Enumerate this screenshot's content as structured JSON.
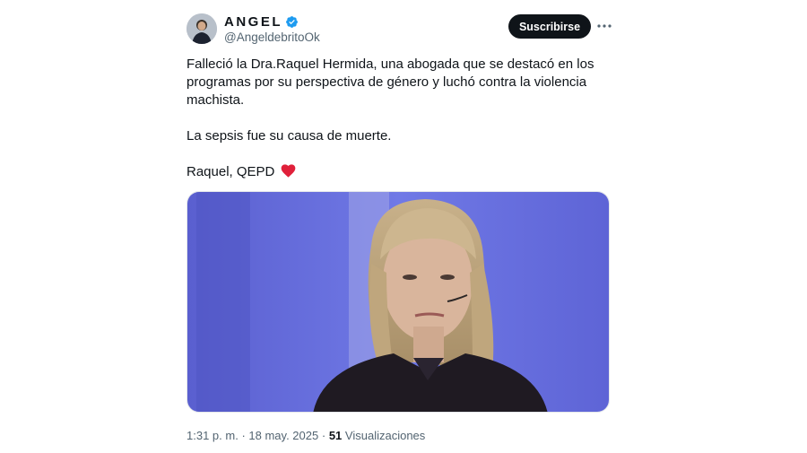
{
  "author": {
    "display_name": "ANGEL",
    "handle": "@AngeldebritoOk",
    "verified": true,
    "verified_color": "#1d9bf0"
  },
  "actions": {
    "subscribe_label": "Suscribirse",
    "more_icon": "more-horizontal-icon"
  },
  "tweet": {
    "paragraph_1": "Falleció la Dra.Raquel Hermida, una abogada que se destacó en los programas por su perspectiva de  género y luchó contra la violencia machista.",
    "paragraph_2": "La sepsis fue su causa de muerte.",
    "paragraph_3": "Raquel, QEPD",
    "emoji": "red-heart-icon"
  },
  "media": {
    "description_icon": "photo",
    "background_color": "#6b73e0"
  },
  "meta": {
    "time": "1:31 p. m.",
    "separator": "·",
    "date": "18 may. 2025",
    "views_count": "51",
    "views_label": "Visualizaciones"
  }
}
